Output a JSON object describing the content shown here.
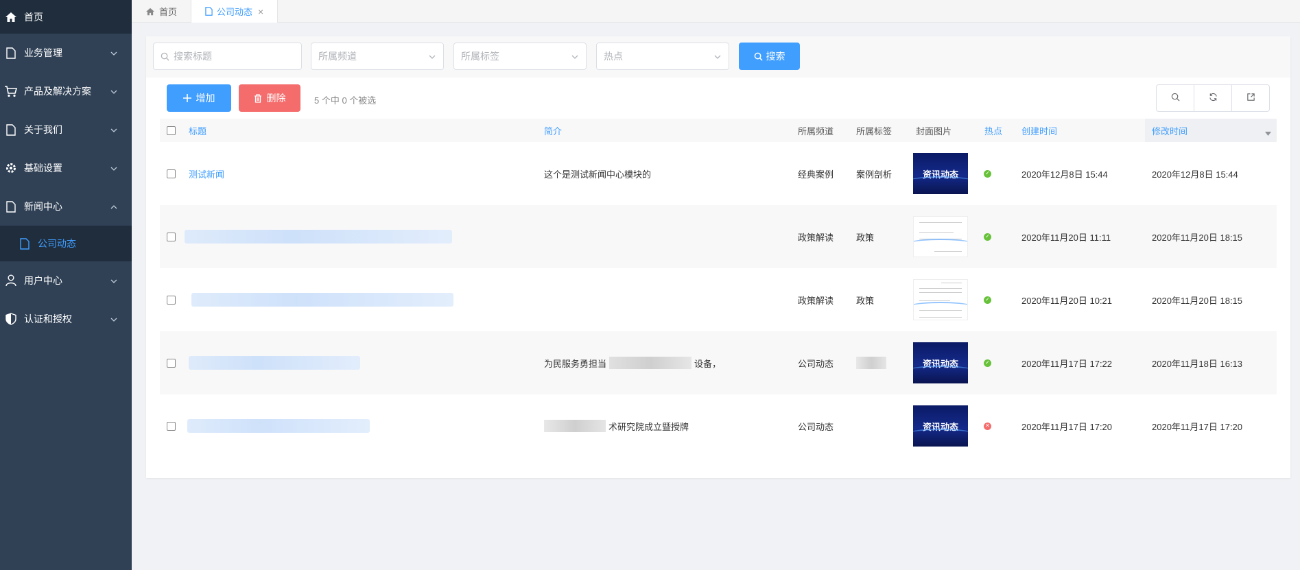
{
  "sidebar": {
    "items": [
      {
        "label": "首页",
        "icon": "home-icon"
      },
      {
        "label": "业务管理",
        "icon": "document-icon"
      },
      {
        "label": "产品及解决方案",
        "icon": "cart-icon"
      },
      {
        "label": "关于我们",
        "icon": "document-icon"
      },
      {
        "label": "基础设置",
        "icon": "gear-icon"
      },
      {
        "label": "新闻中心",
        "icon": "document-icon"
      },
      {
        "label": "公司动态",
        "icon": "document-icon"
      },
      {
        "label": "用户中心",
        "icon": "user-icon"
      },
      {
        "label": "认证和授权",
        "icon": "shield-icon"
      }
    ]
  },
  "tabs": [
    {
      "label": "首页"
    },
    {
      "label": "公司动态",
      "close": "×"
    }
  ],
  "filters": {
    "search_placeholder": "搜索标题",
    "channel_placeholder": "所属频道",
    "tag_placeholder": "所属标签",
    "hot_placeholder": "热点",
    "search_button": "搜索"
  },
  "toolbar": {
    "add_label": "增加",
    "delete_label": "删除",
    "selection_info": "5 个中 0 个被选"
  },
  "table": {
    "headers": {
      "title": "标题",
      "summary": "简介",
      "channel": "所属频道",
      "tag": "所属标签",
      "cover": "封面图片",
      "hot": "热点",
      "created": "创建时间",
      "modified": "修改时间"
    },
    "rows": [
      {
        "title": "测试新闻",
        "summary": "这个是测试新闻中心模块的",
        "channel": "经典案例",
        "tag": "案例剖析",
        "cover_text": "资讯动态",
        "hot": true,
        "created": "2020年12月8日 15:44",
        "modified": "2020年12月8日 15:44"
      },
      {
        "title": "",
        "summary": "",
        "channel": "政策解读",
        "tag": "政策",
        "cover_text": "",
        "hot": true,
        "created": "2020年11月20日 11:11",
        "modified": "2020年11月20日 18:15"
      },
      {
        "title": "",
        "summary": "",
        "channel": "政策解读",
        "tag": "政策",
        "cover_text": "",
        "hot": true,
        "created": "2020年11月20日 10:21",
        "modified": "2020年11月20日 18:15"
      },
      {
        "title": "",
        "summary_start": "为民服务勇担当",
        "summary_end": "设备，",
        "channel": "公司动态",
        "tag": "",
        "cover_text": "资讯动态",
        "hot": true,
        "created": "2020年11月17日 17:22",
        "modified": "2020年11月18日 16:13"
      },
      {
        "title": "",
        "summary_end": "术研究院成立暨授牌",
        "channel": "公司动态",
        "tag": "",
        "cover_text": "资讯动态",
        "hot": false,
        "created": "2020年11月17日 17:20",
        "modified": "2020年11月17日 17:20"
      }
    ]
  },
  "colors": {
    "sidebar_bg": "#304156",
    "sidebar_active_bg": "#1f2d3d",
    "primary": "#409eff",
    "danger": "#f56c6c",
    "success": "#67c23a"
  }
}
